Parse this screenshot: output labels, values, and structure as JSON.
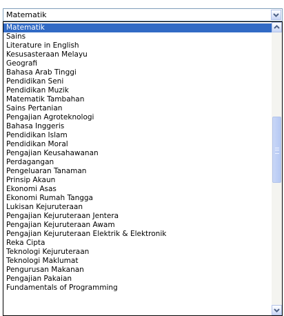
{
  "select": {
    "value": "Matematik",
    "arrow_icon": "chevron-down-icon"
  },
  "dropdown": {
    "options": [
      "Matematik",
      "Sains",
      "Literature in English",
      "Kesusasteraan Melayu",
      "Geografi",
      "Bahasa Arab Tinggi",
      "Pendidikan Seni",
      "Pendidikan Muzik",
      "Matematik Tambahan",
      "Sains Pertanian",
      "Pengajian Agroteknologi",
      "Bahasa Inggeris",
      "Pendidikan Islam",
      "Pendidikan Moral",
      "Pengajian Keusahawanan",
      "Perdagangan",
      "Pengeluaran Tanaman",
      "Prinsip Akaun",
      "Ekonomi Asas",
      "Ekonomi Rumah Tangga",
      "Lukisan Kejuruteraan",
      "Pengajian Kejuruteraan Jentera",
      "Pengajian Kejuruteraan Awam",
      "Pengajian Kejuruteraan Elektrik & Elektronik",
      "Reka Cipta",
      "Teknologi Kejuruteraan",
      "Teknologi Maklumat",
      "Pengurusan Makanan",
      "Pengajian Pakaian",
      "Fundamentals of Programming"
    ],
    "selected_index": 0
  },
  "colors": {
    "selection": "#316ac5",
    "border": "#7f9db9"
  }
}
